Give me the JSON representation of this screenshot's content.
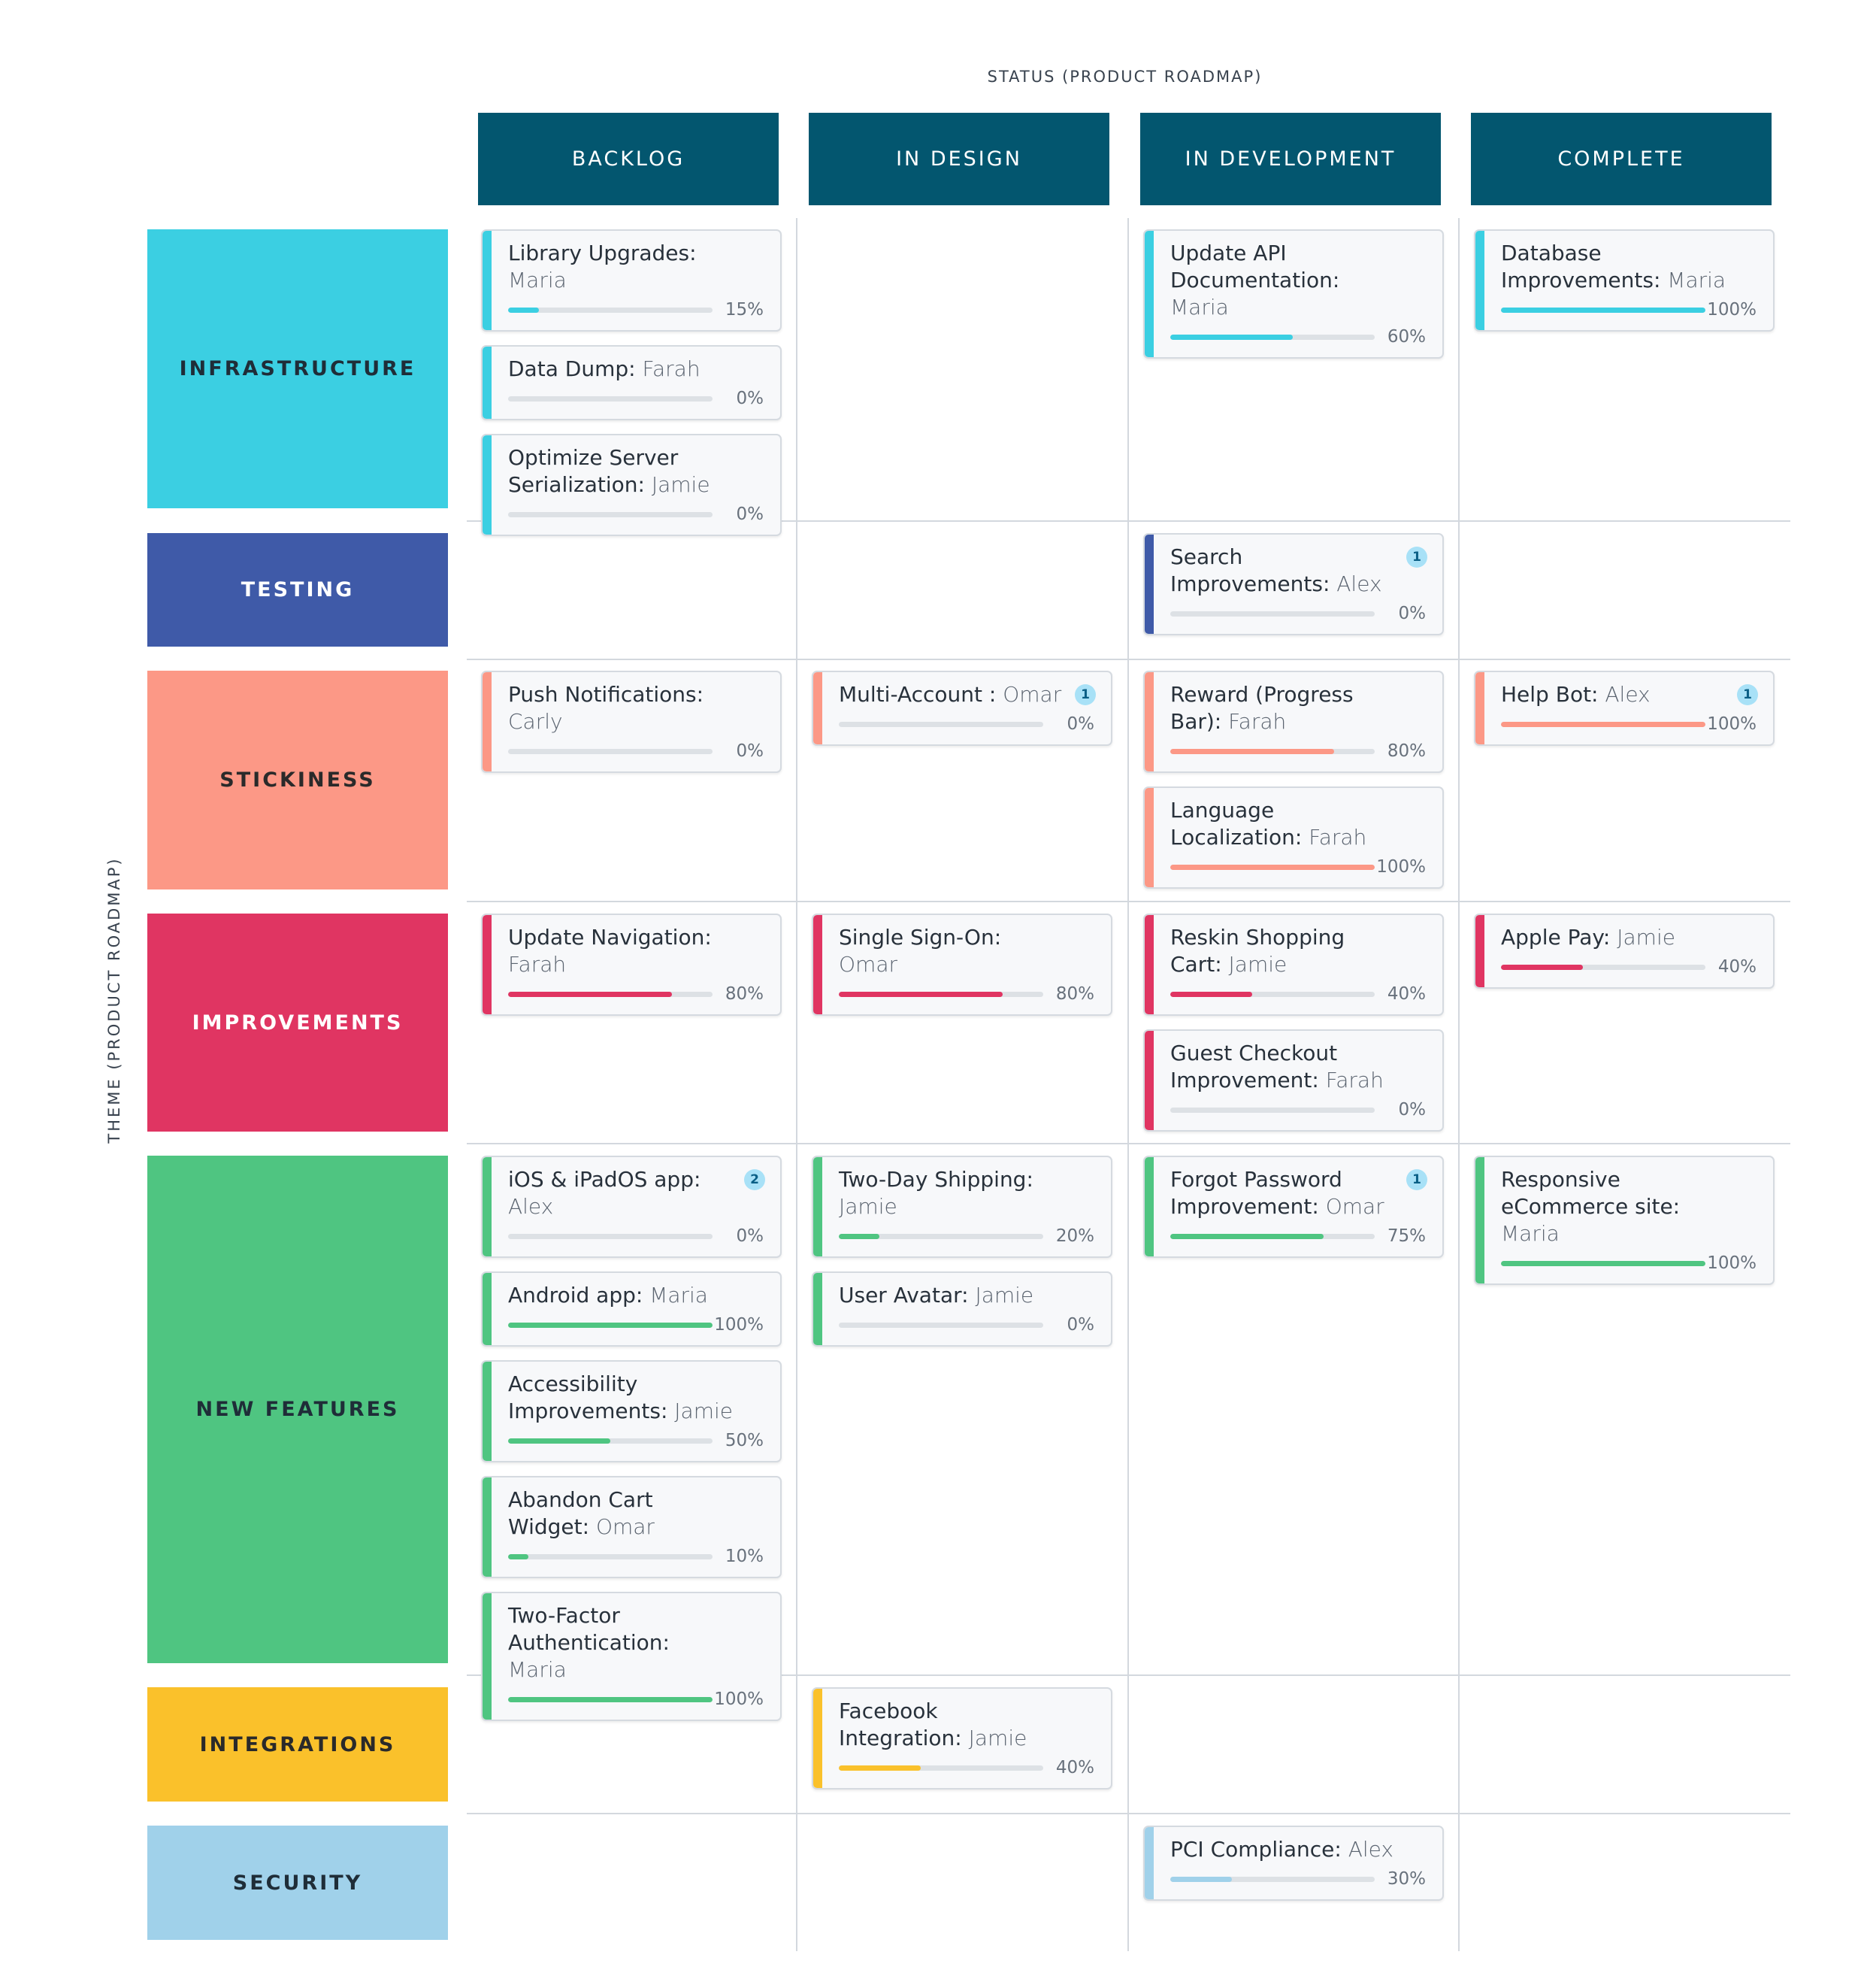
{
  "status_axis_label": "STATUS (PRODUCT ROADMAP)",
  "theme_axis_label": "THEME (PRODUCT ROADMAP)",
  "columns": [
    {
      "id": "backlog",
      "label": "BACKLOG"
    },
    {
      "id": "in_design",
      "label": "IN DESIGN"
    },
    {
      "id": "in_development",
      "label": "IN DEVELOPMENT"
    },
    {
      "id": "complete",
      "label": "COMPLETE"
    }
  ],
  "header_color": "#03566f",
  "rows": [
    {
      "id": "infrastructure",
      "label": "INFRASTRUCTURE",
      "color": "#3bcfe2",
      "text_color": "#1f2d38",
      "cells": [
        [
          {
            "title": "Library Upgrades:",
            "owner": "Maria",
            "progress": 15,
            "badge": null
          },
          {
            "title": "Data Dump:",
            "owner": "Farah",
            "progress": 0,
            "badge": null
          },
          {
            "title": "Optimize Server Serialization:",
            "owner": "Jamie",
            "progress": 0,
            "badge": null
          }
        ],
        [],
        [
          {
            "title": "Update API Documentation:",
            "owner": "Maria",
            "progress": 60,
            "badge": null
          }
        ],
        [
          {
            "title": "Database Improvements:",
            "owner": "Maria",
            "progress": 100,
            "badge": null
          }
        ]
      ]
    },
    {
      "id": "testing",
      "label": "TESTING",
      "color": "#3f5aa8",
      "text_color": "#ffffff",
      "cells": [
        [],
        [],
        [
          {
            "title": "Search Improvements:",
            "owner": "Alex",
            "progress": 0,
            "badge": "1"
          }
        ],
        []
      ]
    },
    {
      "id": "stickiness",
      "label": "STICKINESS",
      "color": "#fc9886",
      "text_color": "#2a2a2a",
      "cells": [
        [
          {
            "title": "Push Notifications:",
            "owner": "Carly",
            "progress": 0,
            "badge": null
          }
        ],
        [
          {
            "title": "Multi-Account :",
            "owner": "Omar",
            "progress": 0,
            "badge": "1"
          }
        ],
        [
          {
            "title": "Reward (Progress Bar):",
            "owner": "Farah",
            "progress": 80,
            "badge": null
          },
          {
            "title": "Language Localization:",
            "owner": "Farah",
            "progress": 100,
            "badge": null
          }
        ],
        [
          {
            "title": "Help Bot:",
            "owner": "Alex",
            "progress": 100,
            "badge": "1"
          }
        ]
      ]
    },
    {
      "id": "improvements",
      "label": "IMPROVEMENTS",
      "color": "#e03562",
      "text_color": "#ffffff",
      "cells": [
        [
          {
            "title": "Update Navigation:",
            "owner": "Farah",
            "progress": 80,
            "badge": null
          }
        ],
        [
          {
            "title": "Single Sign-On:",
            "owner": "Omar",
            "progress": 80,
            "badge": null
          }
        ],
        [
          {
            "title": "Reskin Shopping Cart:",
            "owner": "Jamie",
            "progress": 40,
            "badge": null
          },
          {
            "title": "Guest Checkout Improvement:",
            "owner": "Farah",
            "progress": 0,
            "badge": null
          }
        ],
        [
          {
            "title": "Apple Pay:",
            "owner": "Jamie",
            "progress": 40,
            "badge": null
          }
        ]
      ]
    },
    {
      "id": "new_features",
      "label": "NEW FEATURES",
      "color": "#4fc581",
      "text_color": "#1f2d38",
      "cells": [
        [
          {
            "title": "iOS & iPadOS app:",
            "owner": "Alex",
            "progress": 0,
            "badge": "2"
          },
          {
            "title": "Android app:",
            "owner": "Maria",
            "progress": 100,
            "badge": null
          },
          {
            "title": "Accessibility Improvements:",
            "owner": "Jamie",
            "progress": 50,
            "badge": null
          },
          {
            "title": "Abandon Cart Widget:",
            "owner": "Omar",
            "progress": 10,
            "badge": null
          },
          {
            "title": "Two-Factor Authentication:",
            "owner": "Maria",
            "progress": 100,
            "badge": null
          }
        ],
        [
          {
            "title": "Two-Day Shipping:",
            "owner": "Jamie",
            "progress": 20,
            "badge": null
          },
          {
            "title": "User Avatar:",
            "owner": "Jamie",
            "progress": 0,
            "badge": null
          }
        ],
        [
          {
            "title": "Forgot Password Improvement:",
            "owner": "Omar",
            "progress": 75,
            "badge": "1"
          }
        ],
        [
          {
            "title": "Responsive eCommerce site:",
            "owner": "Maria",
            "progress": 100,
            "badge": null
          }
        ]
      ]
    },
    {
      "id": "integrations",
      "label": "INTEGRATIONS",
      "color": "#fac12b",
      "text_color": "#2a2a2a",
      "cells": [
        [],
        [
          {
            "title": "Facebook Integration:",
            "owner": "Jamie",
            "progress": 40,
            "badge": null
          }
        ],
        [],
        []
      ]
    },
    {
      "id": "security",
      "label": "SECURITY",
      "color": "#a0d1ea",
      "text_color": "#1f2d38",
      "cells": [
        [],
        [],
        [
          {
            "title": "PCI Compliance:",
            "owner": "Alex",
            "progress": 30,
            "badge": null
          }
        ],
        []
      ]
    }
  ]
}
